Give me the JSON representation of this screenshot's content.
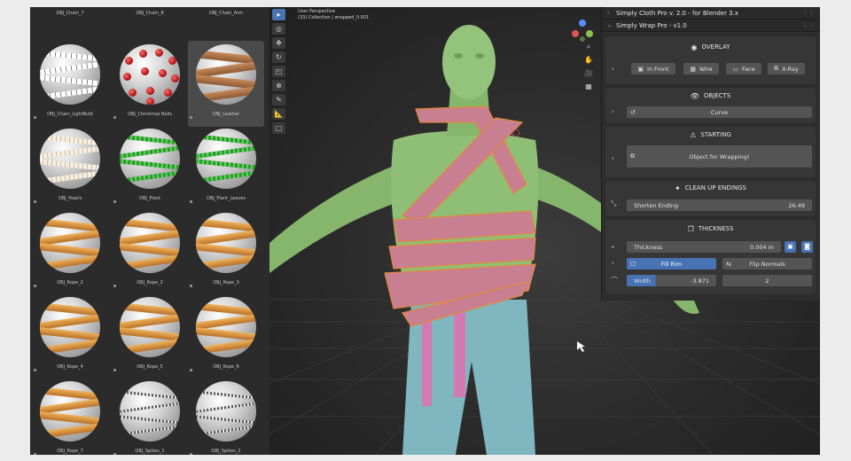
{
  "asset_browser": {
    "top_labels": [
      "OBJ_Chain_7",
      "OBJ_Chain_8",
      "OBJ_Chain_Arm"
    ],
    "tiles": [
      {
        "label": "OBJ_Chain_LightBulb",
        "kind": "chain"
      },
      {
        "label": "OBJ_Christmas Balls",
        "kind": "balls"
      },
      {
        "label": "OBJ_Leather",
        "kind": "leather",
        "selected": true
      },
      {
        "label": "OBJ_Pearls",
        "kind": "pearl"
      },
      {
        "label": "OBJ_Plant",
        "kind": "plant"
      },
      {
        "label": "OBJ_Plant_Leaves",
        "kind": "plant"
      },
      {
        "label": "OBJ_Rope_2",
        "kind": "rope"
      },
      {
        "label": "OBJ_Rope_2",
        "kind": "rope"
      },
      {
        "label": "OBJ_Rope_3",
        "kind": "rope"
      },
      {
        "label": "OBJ_Rope_4",
        "kind": "rope"
      },
      {
        "label": "OBJ_Rope_5",
        "kind": "rope"
      },
      {
        "label": "OBJ_Rope_6",
        "kind": "rope"
      },
      {
        "label": "OBJ_Rope_7",
        "kind": "rope"
      },
      {
        "label": "OBJ_Spikes_1",
        "kind": "wire"
      },
      {
        "label": "OBJ_Spikes_2",
        "kind": "wire"
      }
    ]
  },
  "viewport": {
    "mode_line": "User Perspective",
    "collection_line": "(33) Collection | wrapped_0.001",
    "gizmo_axes": [
      "X",
      "Y",
      "Z"
    ]
  },
  "panel": {
    "cloth_header": "Simply Cloth Pro v. 2.0 - for Blender 3.x",
    "wrap_header": "Simply Wrap Pro - v1.0",
    "overlay": {
      "title": "OVERLAY",
      "buttons": [
        "In Front",
        "Wire",
        "Face",
        "X-Ray"
      ]
    },
    "objects": {
      "title": "OBJECTS",
      "curve_label": "Curve"
    },
    "starting": {
      "title": "STARTING",
      "button": "Object for Wrapping!"
    },
    "cleanup": {
      "title": "CLEAN UP ENDINGS",
      "field_label": "Shorten Ending",
      "field_value": "26.49"
    },
    "thickness": {
      "title": "THICKNESS",
      "thickness_label": "Thickness",
      "thickness_value": "0.004 m",
      "fill_rim": "Fill Rim",
      "flip_normals": "Flip Normals",
      "width_label": "Width",
      "width_value": "-3.871",
      "count_value": "2"
    }
  },
  "colors": {
    "accent": "#4772b3",
    "body": "#8fbf76",
    "wrap": "#c97f92",
    "pants": "#7fb6bf",
    "belt": "#d27ab3"
  }
}
